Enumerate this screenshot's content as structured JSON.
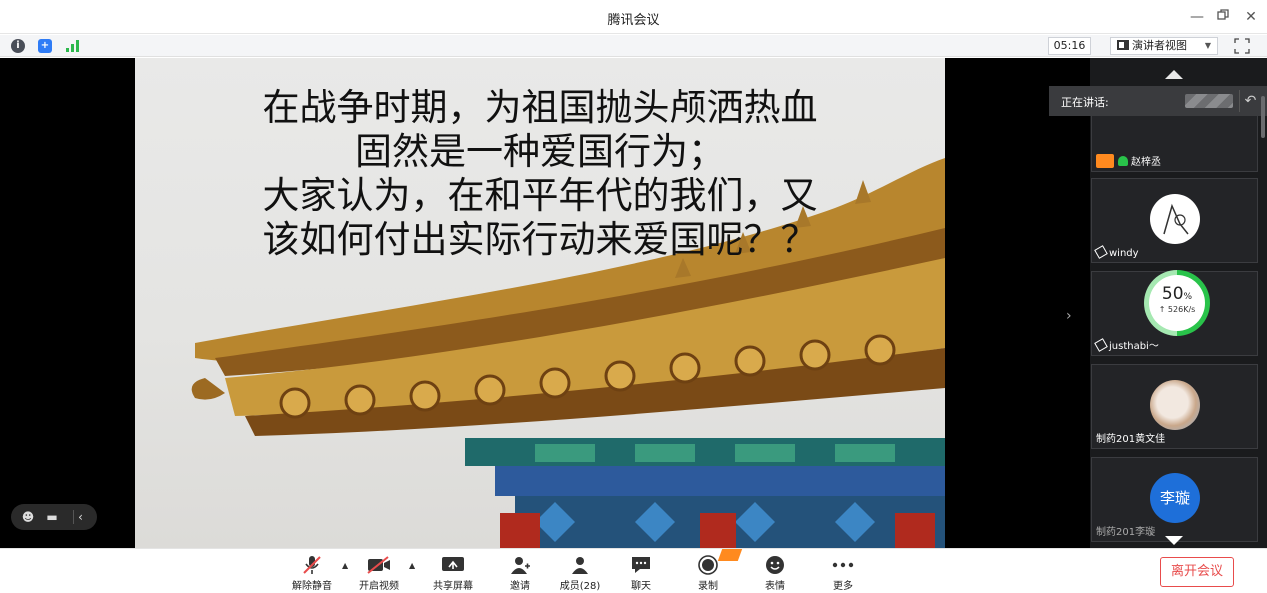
{
  "window": {
    "title": "腾讯会议"
  },
  "statusbar": {
    "timer": "05:16",
    "view_mode": "演讲者视图",
    "colors": {
      "shield": "#2f7cf6",
      "signal": "#2db84d"
    }
  },
  "slide": {
    "lines": [
      "在战争时期，为祖国抛头颅洒热血",
      "固然是一种爱国行为；",
      "大家认为，在和平年代的我们，又",
      "该如何付出实际行动来爱国呢？？"
    ]
  },
  "panel": {
    "speaking_label": "正在讲话:",
    "participants": [
      {
        "name": "赵梓丞"
      },
      {
        "name": "windy"
      },
      {
        "name": "justhabi～"
      },
      {
        "name": "制药201黄文佳"
      },
      {
        "name": "制药201李璇",
        "avatar_text": "李璇"
      }
    ],
    "network": {
      "percent": "50",
      "unit": "%",
      "speed": "↑ 526K/s"
    }
  },
  "toolbar": {
    "unmute": "解除静音",
    "start_video": "开启视频",
    "share_screen": "共享屏幕",
    "invite": "邀请",
    "members": "成员(28)",
    "chat": "聊天",
    "record": "录制",
    "emoji": "表情",
    "more": "更多",
    "leave": "离开会议",
    "colors": {
      "leave": "#e84c4c",
      "mute_red": "#e84c4c"
    }
  }
}
